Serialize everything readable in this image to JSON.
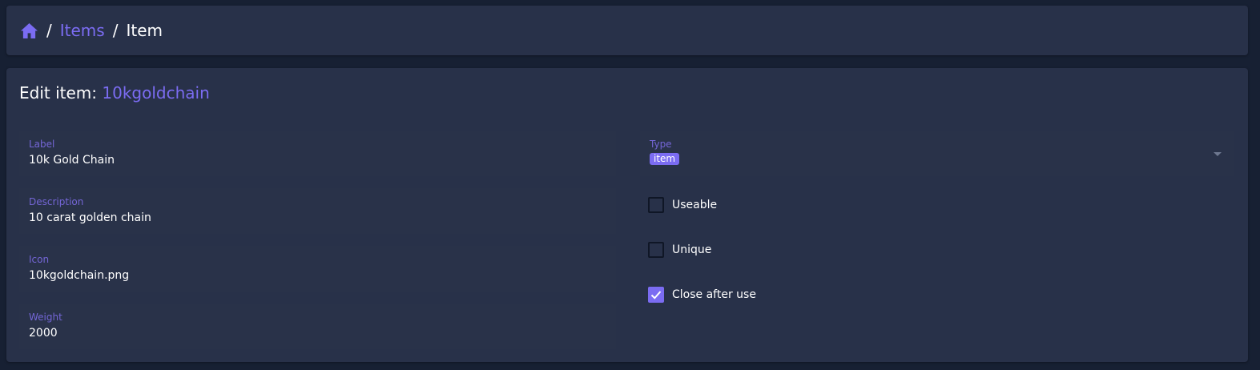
{
  "breadcrumb": {
    "home_icon": "home-icon",
    "separator": "/",
    "items_label": "Items",
    "current_label": "Item"
  },
  "editor": {
    "title_prefix": "Edit item:",
    "item_name": "10kgoldchain",
    "fields": {
      "label": {
        "label": "Label",
        "value": "10k Gold Chain"
      },
      "description": {
        "label": "Description",
        "value": "10 carat golden chain"
      },
      "icon": {
        "label": "Icon",
        "value": "10kgoldchain.png"
      },
      "weight": {
        "label": "Weight",
        "value": "2000"
      },
      "type": {
        "label": "Type",
        "value": "item"
      }
    },
    "checkboxes": {
      "useable": {
        "label": "Useable",
        "checked": false
      },
      "unique": {
        "label": "Unique",
        "checked": false
      },
      "close_after_use": {
        "label": "Close after use",
        "checked": true
      }
    }
  },
  "colors": {
    "accent": "#7b6cf2",
    "background": "#172033",
    "card": "#283149"
  }
}
